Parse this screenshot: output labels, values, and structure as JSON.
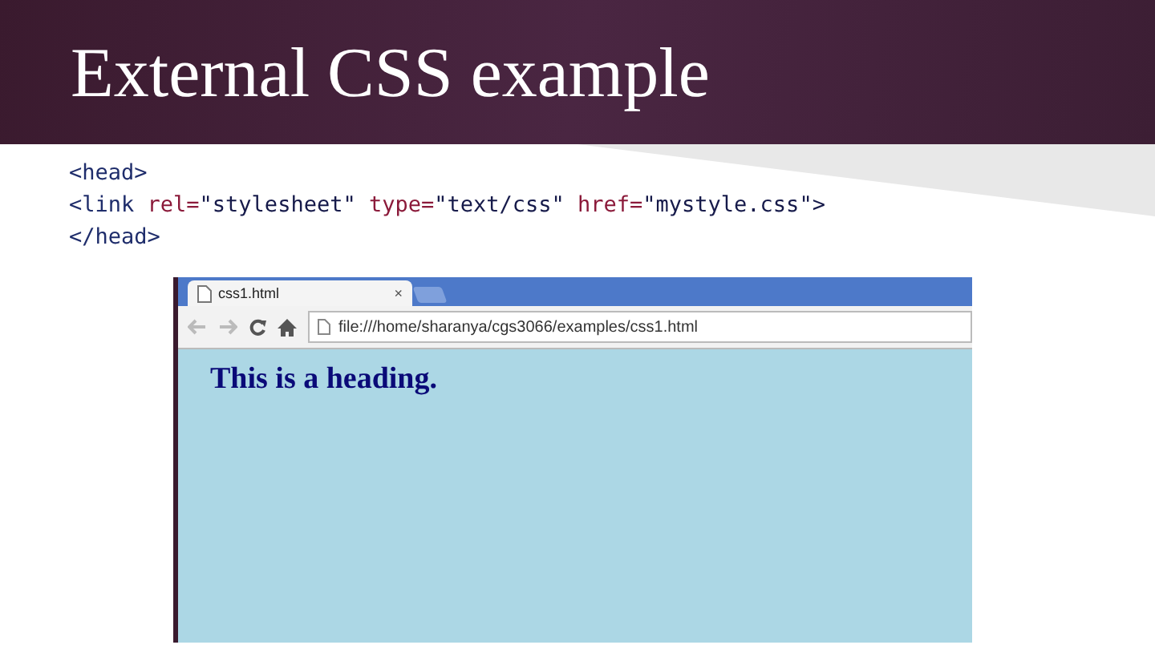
{
  "slide": {
    "title": "External CSS example"
  },
  "code_lines": [
    [
      {
        "kind": "tag",
        "text": "<head>"
      }
    ],
    [
      {
        "kind": "tag",
        "text": "<link "
      },
      {
        "kind": "attr",
        "text": "rel="
      },
      {
        "kind": "value",
        "text": "\"stylesheet\" "
      },
      {
        "kind": "attr",
        "text": "type="
      },
      {
        "kind": "value",
        "text": "\"text/css\" "
      },
      {
        "kind": "attr",
        "text": "href="
      },
      {
        "kind": "value",
        "text": "\"mystyle.css\">"
      }
    ],
    [
      {
        "kind": "tag",
        "text": "</head>"
      }
    ]
  ],
  "browser": {
    "tabs": [
      {
        "label": "css1.html",
        "close": "×",
        "selected": true
      }
    ],
    "address": "file:///home/sharanya/cgs3066/examples/css1.html",
    "page_heading": "This is a heading."
  }
}
